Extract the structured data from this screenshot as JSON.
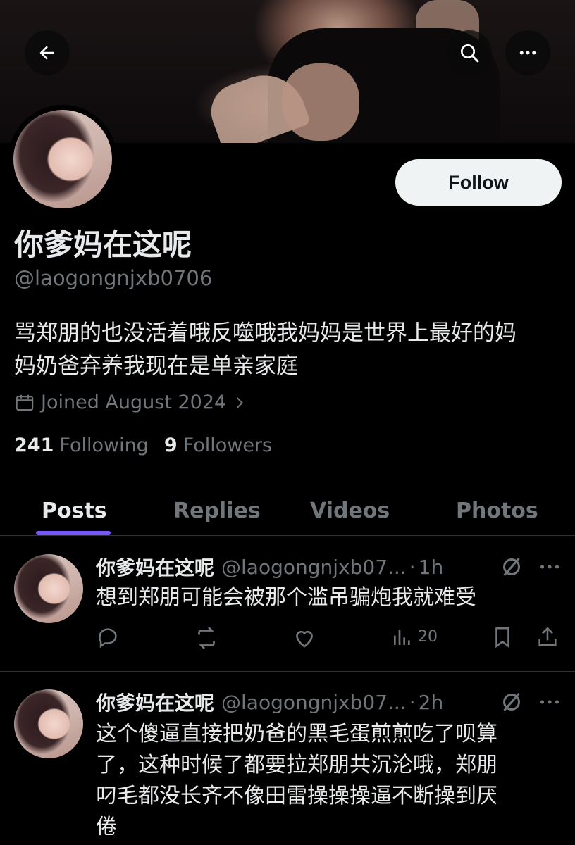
{
  "profile": {
    "display_name": "你爹妈在这呢",
    "handle": "@laogongnjxb0706",
    "bio_line1": "骂郑朋的也没活着哦反噬哦我妈妈是世界上最好的妈",
    "bio_line2": "妈奶爸弃养我现在是单亲家庭",
    "joined": "Joined August 2024",
    "following_count": "241",
    "following_label": "Following",
    "followers_count": "9",
    "followers_label": "Followers"
  },
  "header": {
    "follow_label": "Follow",
    "back_icon": "arrow-left-icon",
    "search_icon": "search-icon",
    "more_icon": "more-icon"
  },
  "tabs": [
    {
      "label": "Posts",
      "active": true
    },
    {
      "label": "Replies",
      "active": false
    },
    {
      "label": "Videos",
      "active": false
    },
    {
      "label": "Photos",
      "active": false
    }
  ],
  "posts": [
    {
      "name": "你爹妈在这呢",
      "handle": "@laogongnjxb07...",
      "dot": "·",
      "time": "1h",
      "text": "想到郑朋可能会被那个滥吊骗炮我就难受",
      "views": "20"
    },
    {
      "name": "你爹妈在这呢",
      "handle": "@laogongnjxb07...",
      "dot": "·",
      "time": "2h",
      "text_lines": [
        "这个傻逼直接把奶爸的黑毛蛋煎煎吃了呗算",
        "了，这种时候了都要拉郑朋共沉沦哦，郑朋",
        "叼毛都没长齐不像田雷操操操逼不断操到厌",
        "倦"
      ]
    }
  ],
  "colors": {
    "accent": "#7856ff",
    "muted": "#71767b",
    "text": "#e7e9ea",
    "background": "#000000"
  }
}
